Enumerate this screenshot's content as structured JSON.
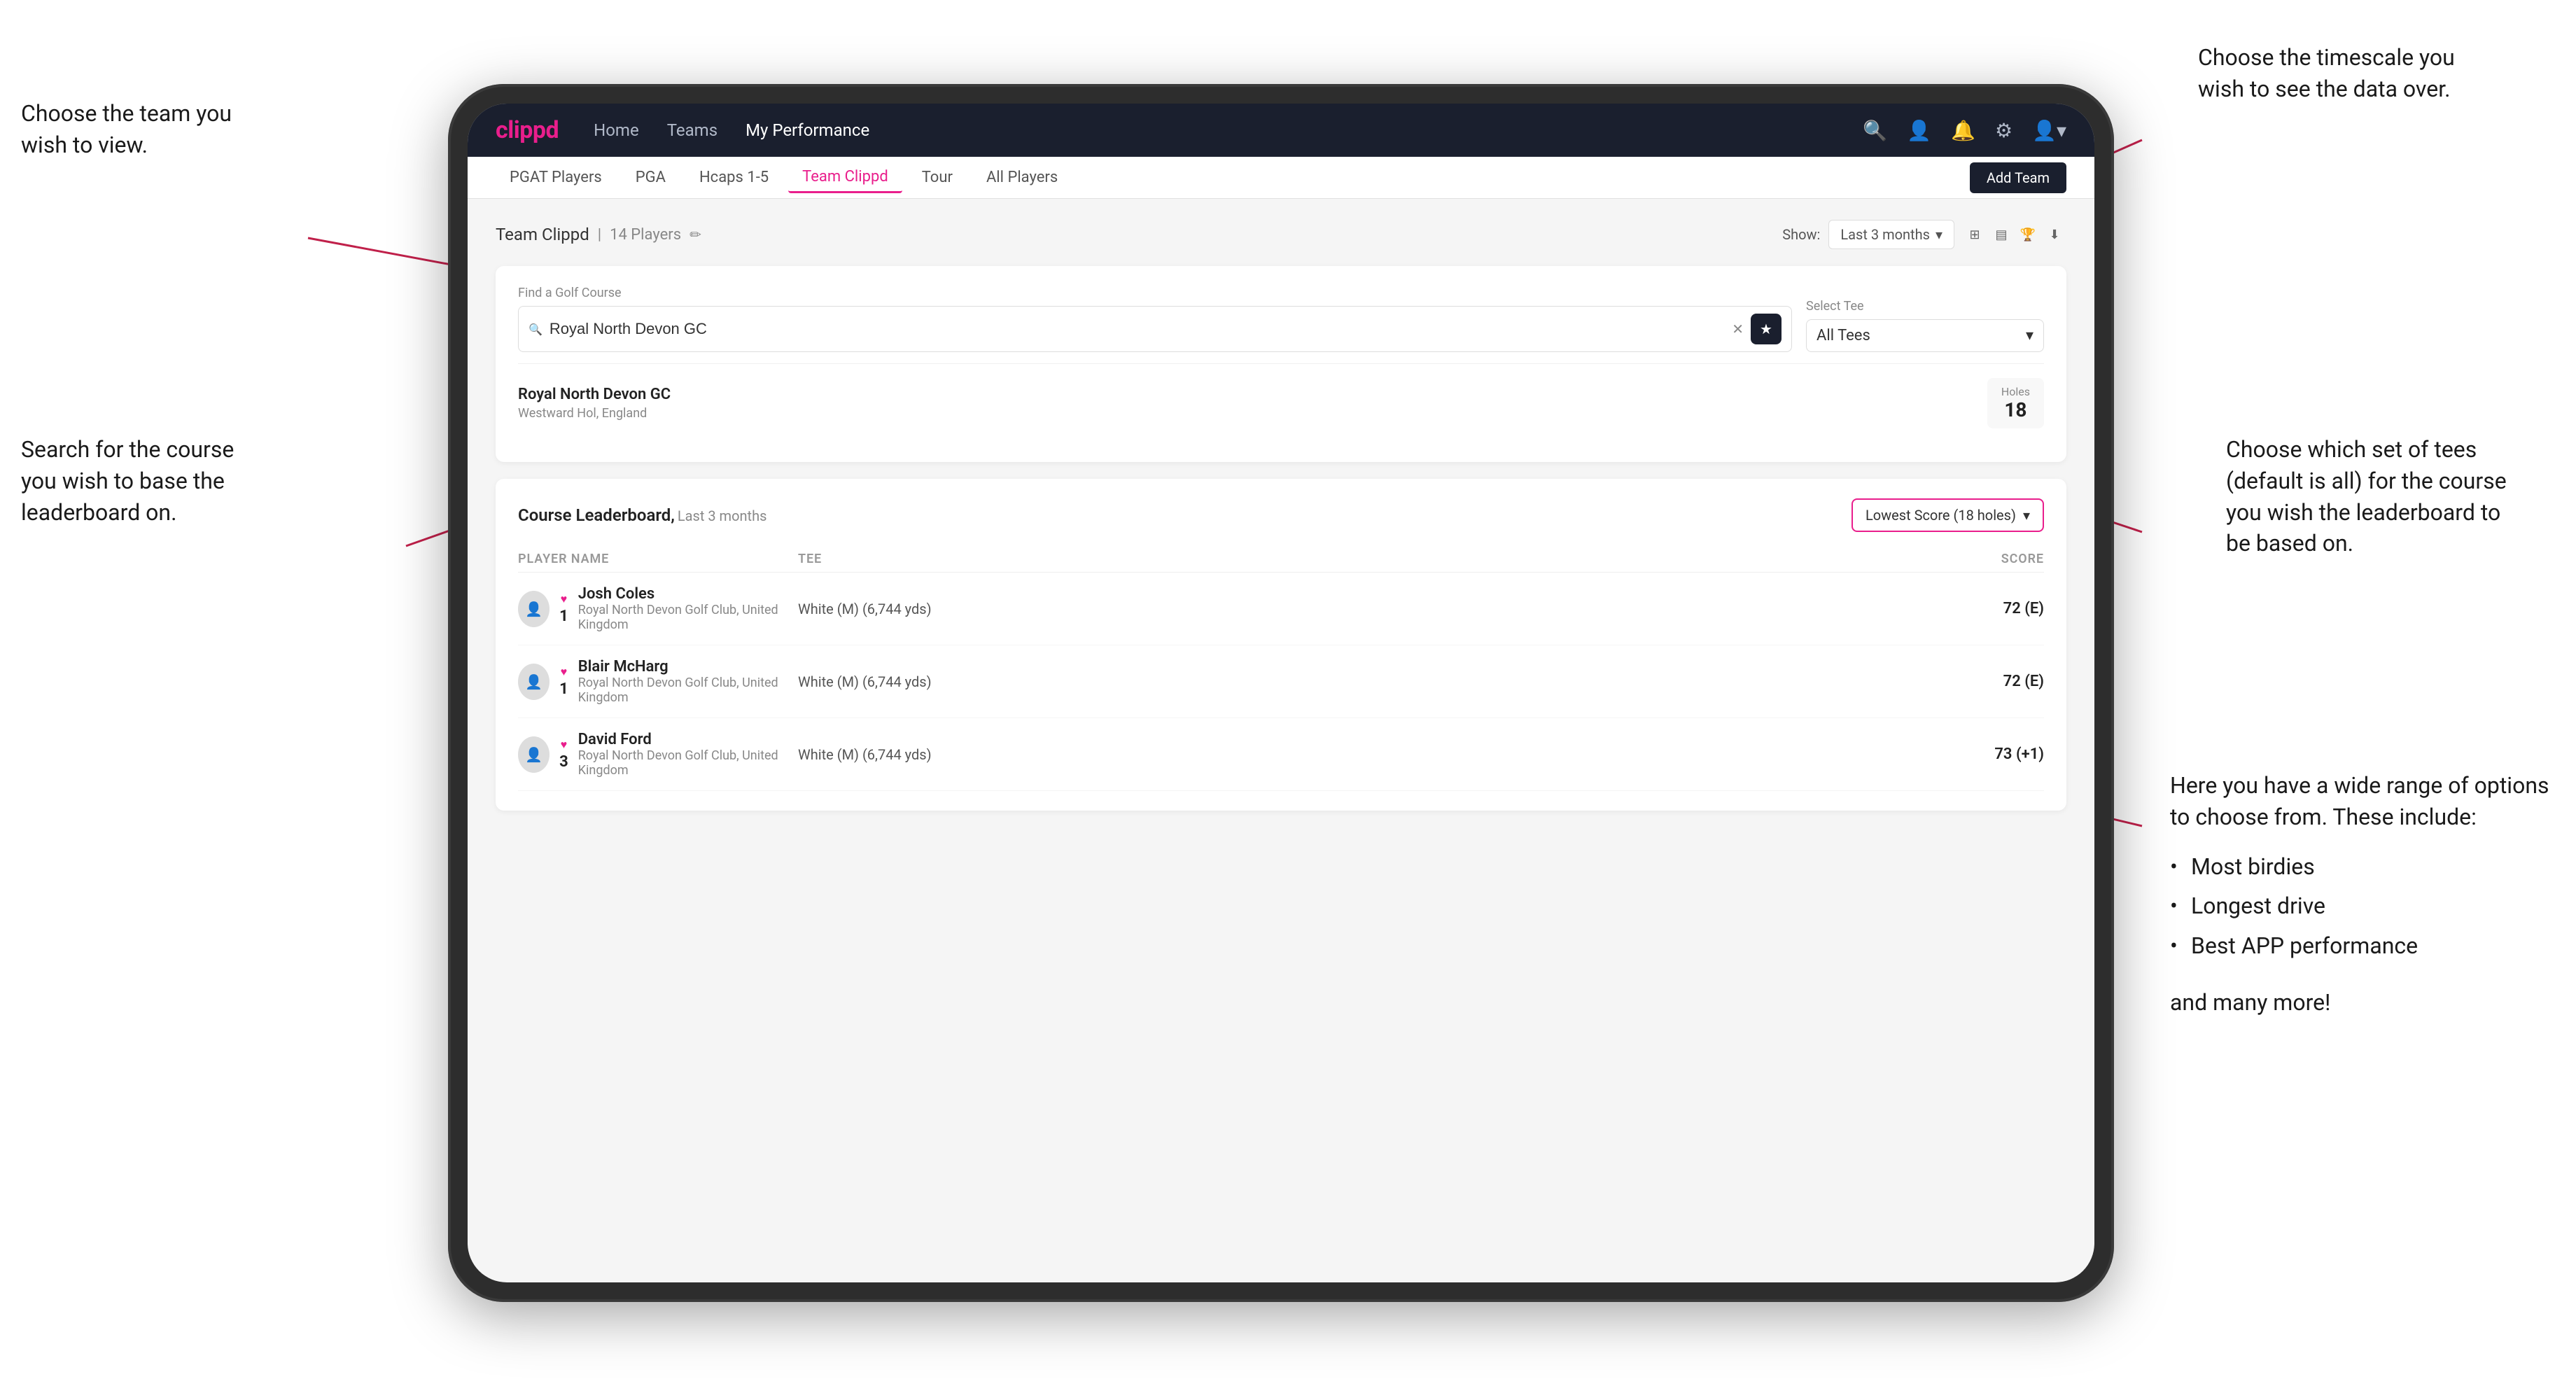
{
  "annotations": {
    "top_left": {
      "line1": "Choose the team you",
      "line2": "wish to view."
    },
    "top_right": {
      "line1": "Choose the timescale you",
      "line2": "wish to see the data over."
    },
    "mid_left": {
      "line1": "Search for the course",
      "line2": "you wish to base the",
      "line3": "leaderboard on."
    },
    "mid_right": {
      "line1": "Choose which set of tees",
      "line2": "(default is all) for the course",
      "line3": "you wish the leaderboard to",
      "line4": "be based on."
    },
    "bottom_right": {
      "intro": "Here you have a wide range of options to choose from. These include:",
      "bullets": [
        "Most birdies",
        "Longest drive",
        "Best APP performance"
      ],
      "outro": "and many more!"
    }
  },
  "navbar": {
    "logo": "clippd",
    "links": [
      "Home",
      "Teams",
      "My Performance"
    ],
    "active_link": "My Performance"
  },
  "subnav": {
    "tabs": [
      "PGAT Players",
      "PGA",
      "Hcaps 1-5",
      "Team Clippd",
      "Tour",
      "All Players"
    ],
    "active_tab": "Team Clippd",
    "add_team_label": "Add Team"
  },
  "team_header": {
    "title": "Team Clippd",
    "player_count": "14 Players",
    "show_label": "Show:",
    "show_value": "Last 3 months"
  },
  "search_section": {
    "find_label": "Find a Golf Course",
    "search_value": "Royal North Devon GC",
    "select_tee_label": "Select Tee",
    "tee_value": "All Tees"
  },
  "course_result": {
    "name": "Royal North Devon GC",
    "location": "Westward Hol, England",
    "holes_label": "Holes",
    "holes_value": "18"
  },
  "leaderboard": {
    "title": "Course Leaderboard,",
    "subtitle": "Last 3 months",
    "score_type": "Lowest Score (18 holes)",
    "columns": {
      "player": "PLAYER NAME",
      "tee": "TEE",
      "score": "SCORE"
    },
    "rows": [
      {
        "rank": "1",
        "name": "Josh Coles",
        "club": "Royal North Devon Golf Club, United Kingdom",
        "tee": "White (M) (6,744 yds)",
        "score": "72 (E)"
      },
      {
        "rank": "1",
        "name": "Blair McHarg",
        "club": "Royal North Devon Golf Club, United Kingdom",
        "tee": "White (M) (6,744 yds)",
        "score": "72 (E)"
      },
      {
        "rank": "3",
        "name": "David Ford",
        "club": "Royal North Devon Golf Club, United Kingdom",
        "tee": "White (M) (6,744 yds)",
        "score": "73 (+1)"
      }
    ]
  }
}
